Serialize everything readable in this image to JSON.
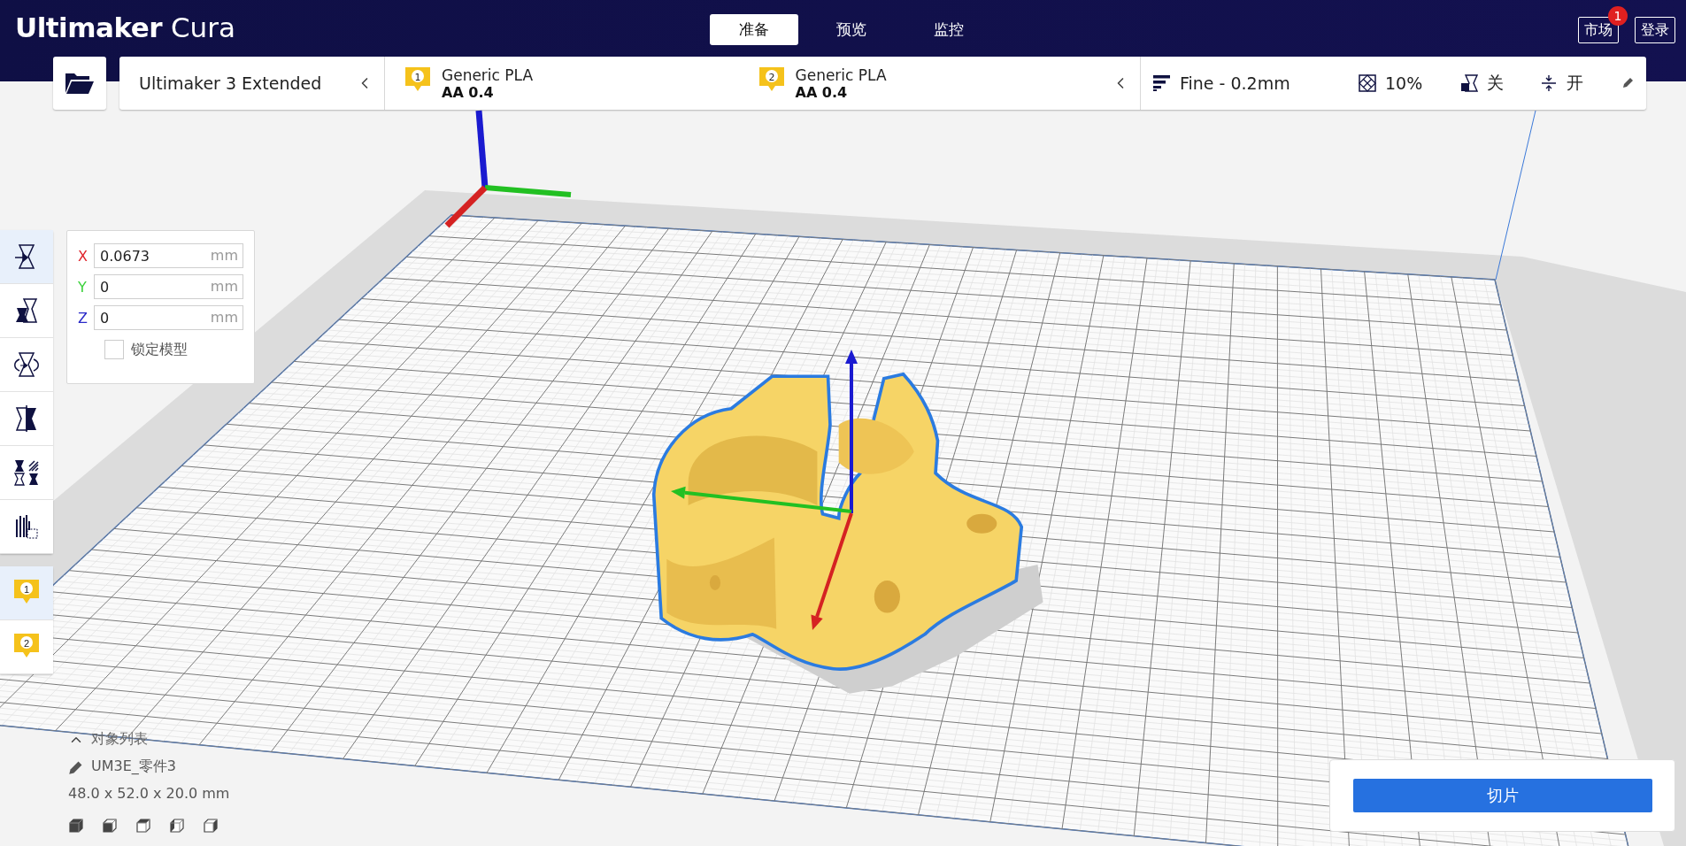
{
  "brand": {
    "bold": "Ultimaker",
    "light": "Cura"
  },
  "stages": [
    {
      "label": "准备",
      "selected": true
    },
    {
      "label": "预览",
      "selected": false
    },
    {
      "label": "监控",
      "selected": false
    }
  ],
  "header_buttons": [
    {
      "label": "市场",
      "badge": "1"
    },
    {
      "label": "登录"
    }
  ],
  "printer": {
    "name": "Ultimaker 3 Extended"
  },
  "extruders": [
    {
      "number": "1",
      "material": "Generic PLA",
      "nozzle": "AA 0.4"
    },
    {
      "number": "2",
      "material": "Generic PLA",
      "nozzle": "AA 0.4"
    }
  ],
  "print_settings": {
    "profile": "Fine - 0.2mm",
    "infill": "10%",
    "support": "关",
    "adhesion": "开"
  },
  "tools": [
    {
      "kind": "move",
      "selected": true
    },
    {
      "kind": "scale",
      "selected": false
    },
    {
      "kind": "rotate",
      "selected": false
    },
    {
      "kind": "mirror",
      "selected": false
    },
    {
      "kind": "per_model",
      "selected": false
    },
    {
      "kind": "support_blocker",
      "selected": false
    }
  ],
  "extruder_buttons": [
    {
      "number": "1",
      "selected": true
    },
    {
      "number": "2",
      "selected": false
    }
  ],
  "move_panel": {
    "fields": [
      {
        "axis": "X",
        "color": "#e0252c",
        "value": "0.0673",
        "unit": "mm"
      },
      {
        "axis": "Y",
        "color": "#3ad13a",
        "value": "0",
        "unit": "mm"
      },
      {
        "axis": "Z",
        "color": "#2a2ac8",
        "value": "0",
        "unit": "mm"
      }
    ],
    "lock": {
      "label": "锁定模型",
      "checked": false
    }
  },
  "object_list": {
    "title": "对象列表",
    "name": "UM3E_零件3",
    "dimensions": "48.0 x 52.0 x 20.0 mm"
  },
  "slice_button": {
    "label": "切片"
  }
}
